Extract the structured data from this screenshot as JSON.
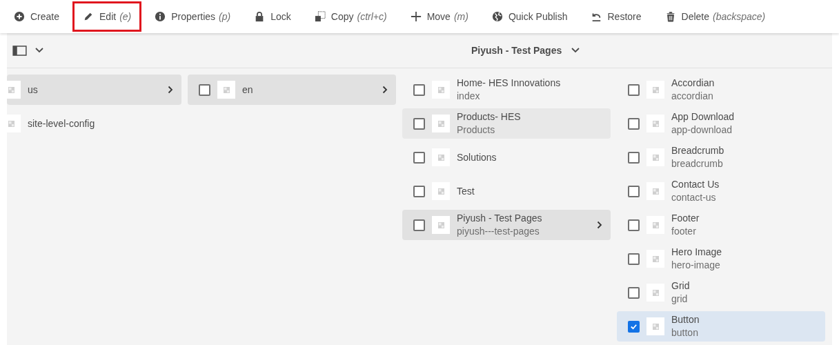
{
  "toolbar": [
    {
      "label": "Create",
      "highlighted": false
    },
    {
      "label": "Edit",
      "shortcut": "(e)",
      "highlighted": true
    },
    {
      "label": "Properties",
      "shortcut": "(p)",
      "highlighted": false
    },
    {
      "label": "Lock",
      "highlighted": false
    },
    {
      "label": "Copy",
      "shortcut": "(ctrl+c)",
      "highlighted": false
    },
    {
      "label": "Move",
      "shortcut": "(m)",
      "highlighted": false
    },
    {
      "label": "Quick Publish",
      "highlighted": false
    },
    {
      "label": "Restore",
      "highlighted": false
    },
    {
      "label": "Delete",
      "shortcut": "(backspace)",
      "highlighted": false
    }
  ],
  "header": {
    "title": "Piyush - Test Pages"
  },
  "columns": [
    {
      "items": [
        {
          "title": "us",
          "selected": false,
          "expanded": true
        },
        {
          "title": "site-level-config",
          "selected": false,
          "expanded": false
        }
      ]
    },
    {
      "items": [
        {
          "title": "en",
          "selected": false,
          "expanded": true,
          "checked": false
        }
      ]
    },
    {
      "items": [
        {
          "title": "Home- HES Innovations",
          "subtitle": "index",
          "selected": false,
          "expanded": false,
          "checked": false
        },
        {
          "title": "Products- HES",
          "subtitle": "Products",
          "selected": false,
          "expanded": false,
          "hovered": true,
          "checked": false
        },
        {
          "title": "Solutions",
          "selected": false,
          "expanded": false,
          "checked": false
        },
        {
          "title": "Test",
          "selected": false,
          "expanded": false,
          "checked": false
        },
        {
          "title": "Piyush - Test Pages",
          "subtitle": "piyush---test-pages",
          "selected": false,
          "expanded": true,
          "checked": false
        }
      ]
    },
    {
      "items": [
        {
          "title": "Accordian",
          "subtitle": "accordian",
          "selected": false,
          "expanded": false,
          "checked": false
        },
        {
          "title": "App Download",
          "subtitle": "app-download",
          "selected": false,
          "expanded": false,
          "checked": false
        },
        {
          "title": "Breadcrumb",
          "subtitle": "breadcrumb",
          "selected": false,
          "expanded": false,
          "checked": false
        },
        {
          "title": "Contact Us",
          "subtitle": "contact-us",
          "selected": false,
          "expanded": false,
          "checked": false
        },
        {
          "title": "Footer",
          "subtitle": "footer",
          "selected": false,
          "expanded": false,
          "checked": false
        },
        {
          "title": "Hero Image",
          "subtitle": "hero-image",
          "selected": false,
          "expanded": false,
          "checked": false
        },
        {
          "title": "Grid",
          "subtitle": "grid",
          "selected": false,
          "expanded": false,
          "checked": false
        },
        {
          "title": "Button",
          "subtitle": "button",
          "selected": true,
          "expanded": false,
          "checked": true
        }
      ]
    }
  ]
}
